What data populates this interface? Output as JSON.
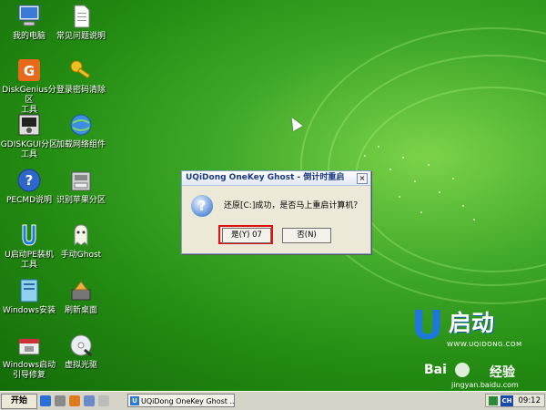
{
  "desktop_icons": [
    {
      "label": "我的电脑",
      "icon": "computer-icon"
    },
    {
      "label": "常见问题说明",
      "icon": "document-icon"
    },
    {
      "label": "DiskGenius分区\n工具",
      "icon": "diskgenius-icon"
    },
    {
      "label": "登录密码清除",
      "icon": "key-icon"
    },
    {
      "label": "GDISKGUI分区\n工具",
      "icon": "gdisk-icon"
    },
    {
      "label": "加载网络组件",
      "icon": "network-icon"
    },
    {
      "label": "PECMD说明",
      "icon": "help-icon"
    },
    {
      "label": "识别苹果分区",
      "icon": "apple-disk-icon"
    },
    {
      "label": "U启动PE装机\n工具",
      "icon": "ustart-icon"
    },
    {
      "label": "手动Ghost",
      "icon": "ghost-icon"
    },
    {
      "label": "Windows安装",
      "icon": "windows-install-icon"
    },
    {
      "label": "刷新桌面",
      "icon": "refresh-icon"
    },
    {
      "label": "Windows启动\n引导修复",
      "icon": "boot-repair-icon"
    },
    {
      "label": "虚拟光驱",
      "icon": "cdrom-icon"
    }
  ],
  "dialog": {
    "title": "UQiDong OneKey Ghost - 倒计时重启",
    "close": "×",
    "icon": "question-icon",
    "icon_glyph": "?",
    "message": "还原[C:]成功，是否马上重启计算机？",
    "yes_label": "是(Y) 07",
    "no_label": "否(N)"
  },
  "brand": {
    "logo_letter": "U",
    "logo_text": "启动",
    "url": "WWW.UQIDONG.COM"
  },
  "watermark": {
    "text1": "Bai",
    "text2": "经验",
    "text3": "jingyan.baidu.com"
  },
  "taskbar": {
    "start_label": "开始",
    "quick_launch": [
      "ql-icon-1",
      "ql-icon-2",
      "ql-icon-3",
      "ql-icon-4",
      "ql-icon-5"
    ],
    "task_label": "UQiDong OneKey Ghost ...",
    "task_icon": "U",
    "ime_label": "CH",
    "clock": "09:12"
  },
  "colors": {
    "desktop": "#2e9a1c",
    "dialog_title": "#1a3a82",
    "highlight": "#e01010",
    "brand_blue": "#1d78d9"
  }
}
